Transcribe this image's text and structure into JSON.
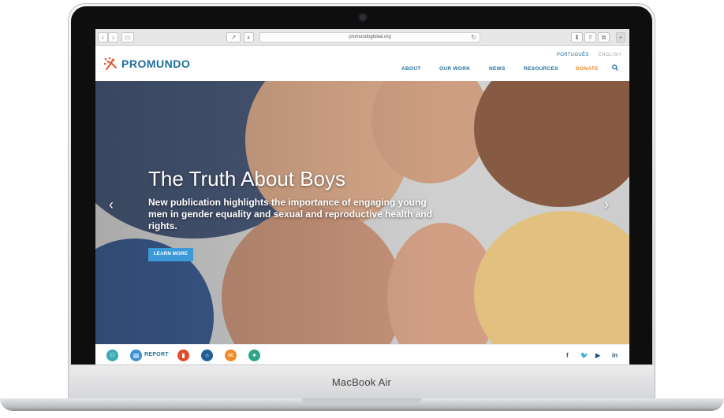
{
  "device": {
    "model_label": "MacBook Air"
  },
  "browser": {
    "url": "promundoglobal.org",
    "nav_back_icon": "chevron-left-icon",
    "nav_forward_icon": "chevron-right-icon"
  },
  "site": {
    "brand": "PROMUNDO",
    "languages": [
      "PORTUGUÊS",
      "ENGLISH"
    ],
    "nav": [
      "ABOUT",
      "OUR WORK",
      "NEWS",
      "RESOURCES",
      "DONATE"
    ],
    "colors": {
      "brand_blue": "#1f6f9d",
      "donate_orange": "#f08a24",
      "button_blue": "#3d9ad9"
    }
  },
  "hero": {
    "title": "The Truth About Boys",
    "subtitle": "New publication highlights the importance of engaging young men in gender equality and sexual and reproductive health and rights.",
    "cta": "LEARN MORE",
    "prev_icon": "chevron-left-icon",
    "next_icon": "chevron-right-icon"
  },
  "footer": {
    "report_label": "REPORT",
    "icons": [
      "people-icon",
      "report-icon",
      "book-icon",
      "search-icon",
      "newsletter-icon",
      "activity-icon"
    ],
    "social": [
      "f",
      "twitter",
      "youtube",
      "in"
    ]
  }
}
